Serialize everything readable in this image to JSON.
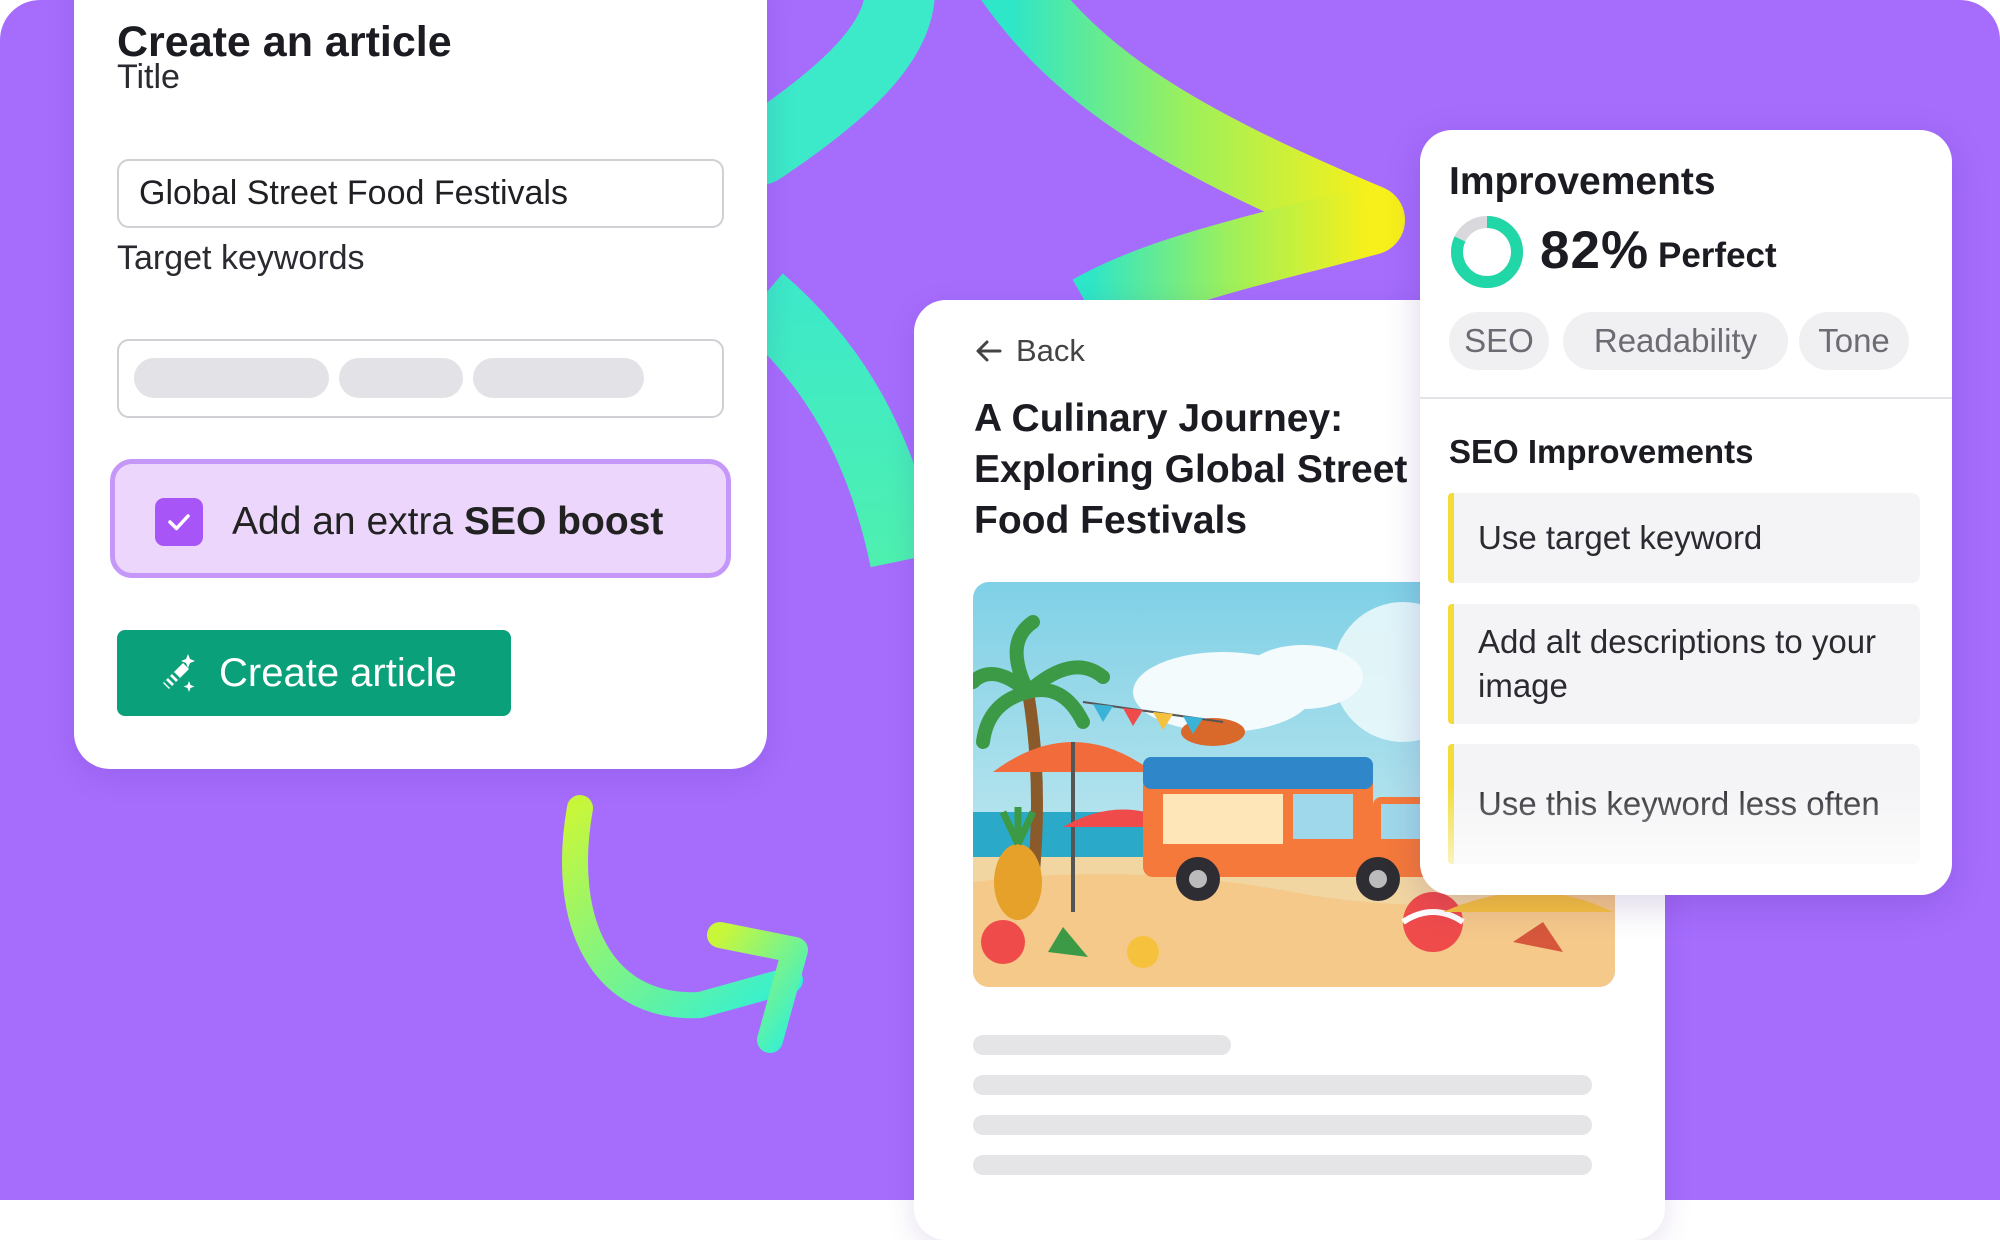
{
  "colors": {
    "background": "#a66dfd",
    "accent_green": "#0aa07a",
    "checkbox": "#a855f7",
    "boost_bg": "#ecd6fc",
    "suggestion_marker": "#f2dc3a"
  },
  "create_card": {
    "heading": "Create an article",
    "title_label": "Title",
    "title_value": "Global Street Food Festivals",
    "keywords_label": "Target keywords",
    "seo_boost": {
      "checked": true,
      "prefix": "Add an extra ",
      "emphasis": "SEO boost"
    },
    "create_button": "Create article",
    "create_icon": "magic-wand-icon"
  },
  "article_card": {
    "back_label": "Back",
    "back_icon": "arrow-left-icon",
    "title": "A Culinary Journey: Exploring Global Street Food Festivals",
    "image_icon": "beach-food-truck-illustration"
  },
  "improvements": {
    "heading": "Improvements",
    "score_value": 82,
    "score_text": "82%",
    "score_label": "Perfect",
    "tabs": [
      "SEO",
      "Readability",
      "Tone"
    ],
    "section_title": "SEO Improvements",
    "suggestions": [
      "Use target keyword",
      "Add alt descriptions to your image",
      "Use this keyword less often"
    ]
  }
}
